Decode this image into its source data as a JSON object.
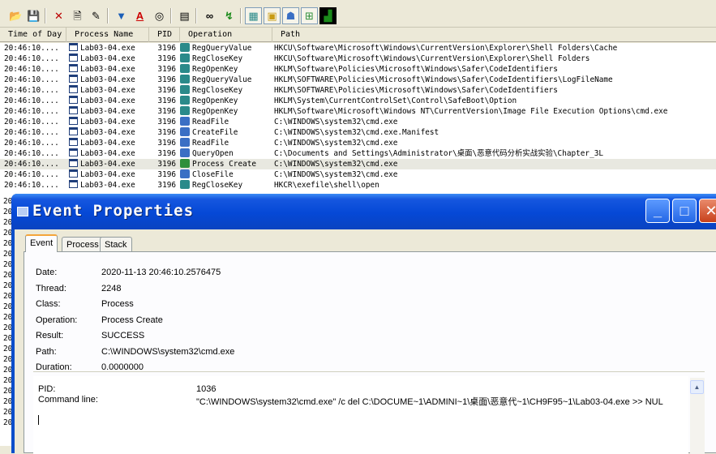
{
  "toolbar": {
    "buttons": [
      {
        "name": "open-icon",
        "glyph": "📂"
      },
      {
        "name": "save-icon",
        "glyph": "💾"
      },
      {
        "name": "capture-icon",
        "glyph": "✕"
      },
      {
        "name": "autoscroll-icon",
        "glyph": "🗎"
      },
      {
        "name": "clear-icon",
        "glyph": "✎"
      },
      {
        "name": "filter-icon",
        "glyph": "▼"
      },
      {
        "name": "highlight-icon",
        "glyph": "A"
      },
      {
        "name": "target-icon",
        "glyph": "◎"
      },
      {
        "name": "process-tree-icon",
        "glyph": "▤"
      },
      {
        "name": "find-icon",
        "glyph": "∞"
      },
      {
        "name": "jump-icon",
        "glyph": "↯"
      },
      {
        "name": "registry-activity-icon",
        "glyph": "▦"
      },
      {
        "name": "file-activity-icon",
        "glyph": "▣"
      },
      {
        "name": "network-activity-icon",
        "glyph": "☗"
      },
      {
        "name": "process-activity-icon",
        "glyph": "⊞"
      },
      {
        "name": "profiling-icon",
        "glyph": "▟"
      }
    ]
  },
  "columns": {
    "time": "Time of Day",
    "process": "Process Name",
    "pid": "PID",
    "operation": "Operation",
    "path": "Path"
  },
  "events": [
    {
      "time": "20:46:10....",
      "process": "Lab03-04.exe",
      "pid": "3196",
      "op": "RegQueryValue",
      "kind": "reg",
      "path": "HKCU\\Software\\Microsoft\\Windows\\CurrentVersion\\Explorer\\Shell Folders\\Cache"
    },
    {
      "time": "20:46:10....",
      "process": "Lab03-04.exe",
      "pid": "3196",
      "op": "RegCloseKey",
      "kind": "reg",
      "path": "HKCU\\Software\\Microsoft\\Windows\\CurrentVersion\\Explorer\\Shell Folders"
    },
    {
      "time": "20:46:10....",
      "process": "Lab03-04.exe",
      "pid": "3196",
      "op": "RegOpenKey",
      "kind": "reg",
      "path": "HKLM\\Software\\Policies\\Microsoft\\Windows\\Safer\\CodeIdentifiers"
    },
    {
      "time": "20:46:10....",
      "process": "Lab03-04.exe",
      "pid": "3196",
      "op": "RegQueryValue",
      "kind": "reg",
      "path": "HKLM\\SOFTWARE\\Policies\\Microsoft\\Windows\\Safer\\CodeIdentifiers\\LogFileName"
    },
    {
      "time": "20:46:10....",
      "process": "Lab03-04.exe",
      "pid": "3196",
      "op": "RegCloseKey",
      "kind": "reg",
      "path": "HKLM\\SOFTWARE\\Policies\\Microsoft\\Windows\\Safer\\CodeIdentifiers"
    },
    {
      "time": "20:46:10....",
      "process": "Lab03-04.exe",
      "pid": "3196",
      "op": "RegOpenKey",
      "kind": "reg",
      "path": "HKLM\\System\\CurrentControlSet\\Control\\SafeBoot\\Option"
    },
    {
      "time": "20:46:10....",
      "process": "Lab03-04.exe",
      "pid": "3196",
      "op": "RegOpenKey",
      "kind": "reg",
      "path": "HKLM\\Software\\Microsoft\\Windows NT\\CurrentVersion\\Image File Execution Options\\cmd.exe"
    },
    {
      "time": "20:46:10....",
      "process": "Lab03-04.exe",
      "pid": "3196",
      "op": "ReadFile",
      "kind": "file",
      "path": "C:\\WINDOWS\\system32\\cmd.exe"
    },
    {
      "time": "20:46:10....",
      "process": "Lab03-04.exe",
      "pid": "3196",
      "op": "CreateFile",
      "kind": "file",
      "path": "C:\\WINDOWS\\system32\\cmd.exe.Manifest"
    },
    {
      "time": "20:46:10....",
      "process": "Lab03-04.exe",
      "pid": "3196",
      "op": "ReadFile",
      "kind": "file",
      "path": "C:\\WINDOWS\\system32\\cmd.exe"
    },
    {
      "time": "20:46:10....",
      "process": "Lab03-04.exe",
      "pid": "3196",
      "op": "QueryOpen",
      "kind": "file",
      "path": "C:\\Documents and Settings\\Administrator\\桌面\\恶意代码分析实战实验\\Chapter_3L"
    },
    {
      "time": "20:46:10....",
      "process": "Lab03-04.exe",
      "pid": "3196",
      "op": "Process Create",
      "kind": "proc",
      "path": "C:\\WINDOWS\\system32\\cmd.exe",
      "selected": true
    },
    {
      "time": "20:46:10....",
      "process": "Lab03-04.exe",
      "pid": "3196",
      "op": "CloseFile",
      "kind": "file",
      "path": "C:\\WINDOWS\\system32\\cmd.exe"
    },
    {
      "time": "20:46:10....",
      "process": "Lab03-04.exe",
      "pid": "3196",
      "op": "RegCloseKey",
      "kind": "reg",
      "path": "HKCR\\exefile\\shell\\open"
    }
  ],
  "left_strip": [
    "20",
    "20",
    "20",
    "20",
    "20",
    "20",
    "20",
    "20",
    "20",
    "20",
    "20",
    "20",
    "20",
    "20",
    "20",
    "20",
    "20",
    "20",
    "20",
    "20",
    "20",
    "20"
  ],
  "dialog": {
    "title": "Event Properties",
    "min_glyph": "_",
    "max_glyph": "□",
    "close_glyph": "✕",
    "tabs": [
      "Event",
      "Process",
      "Stack"
    ],
    "properties": [
      {
        "label": "Date:",
        "value": "2020-11-13 20:46:10.2576475"
      },
      {
        "label": "Thread:",
        "value": "2248"
      },
      {
        "label": "Class:",
        "value": "Process"
      },
      {
        "label": "Operation:",
        "value": "Process Create"
      },
      {
        "label": "Result:",
        "value": "SUCCESS"
      },
      {
        "label": "Path:",
        "value": "C:\\WINDOWS\\system32\\cmd.exe"
      },
      {
        "label": "Duration:",
        "value": "0.0000000"
      }
    ],
    "detail": {
      "pid_label": "PID:",
      "pid_value": "1036",
      "cmd_label": "Command line:",
      "cmd_value": "\"C:\\WINDOWS\\system32\\cmd.exe\" /c del C:\\DOCUME~1\\ADMINI~1\\桌面\\恶意代~1\\CH9F95~1\\Lab03-04.exe >> NUL"
    }
  },
  "colors": {
    "reg_icon": "#2a8a8a",
    "file_icon": "#3a6fc4",
    "proc_icon": "#2f8f3a"
  }
}
